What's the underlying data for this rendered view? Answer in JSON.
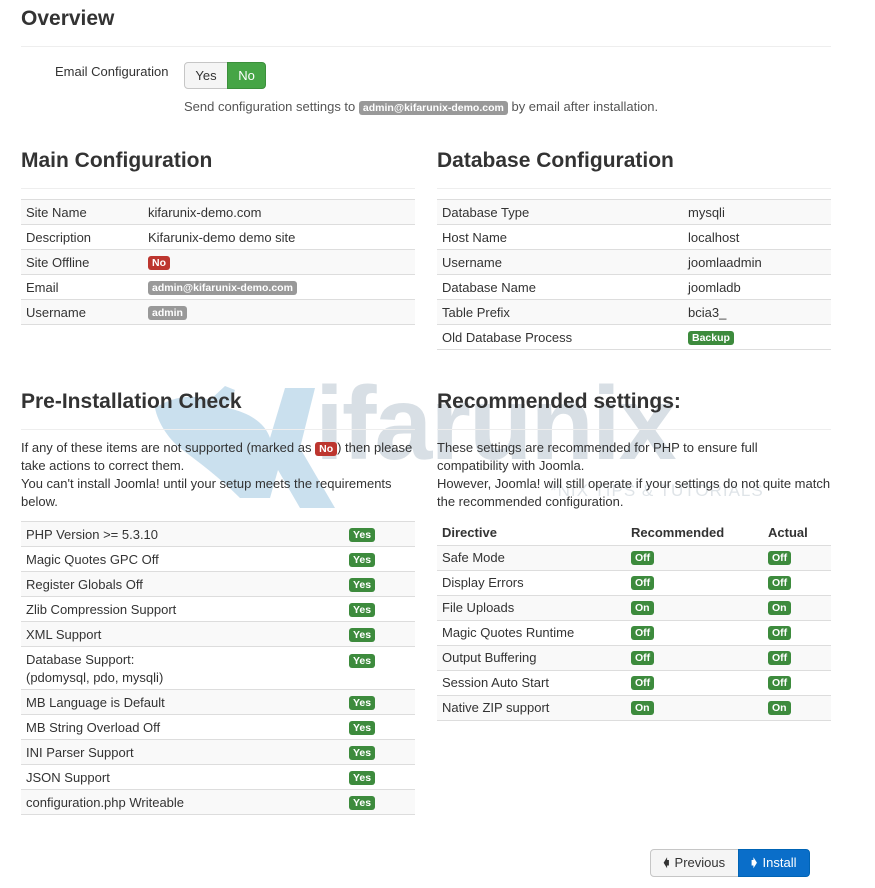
{
  "overview": {
    "title": "Overview",
    "email_config_label": "Email Configuration",
    "email_toggle": {
      "yes_label": "Yes",
      "no_label": "No",
      "selected": "No"
    },
    "email_help_prefix": "Send configuration settings to",
    "email_help_address": "admin@kifarunix-demo.com",
    "email_help_suffix": "by email after installation."
  },
  "main_config": {
    "title": "Main Configuration",
    "rows": [
      {
        "label": "Site Name",
        "value": "kifarunix-demo.com"
      },
      {
        "label": "Description",
        "value": "Kifarunix-demo demo site"
      },
      {
        "label": "Site Offline",
        "value": "No"
      },
      {
        "label": "Email",
        "value": "admin@kifarunix-demo.com"
      },
      {
        "label": "Username",
        "value": "admin"
      }
    ]
  },
  "database_config": {
    "title": "Database Configuration",
    "rows": [
      {
        "label": "Database Type",
        "value": "mysqli"
      },
      {
        "label": "Host Name",
        "value": "localhost"
      },
      {
        "label": "Username",
        "value": "joomlaadmin"
      },
      {
        "label": "Database Name",
        "value": "joomladb"
      },
      {
        "label": "Table Prefix",
        "value": "bcia3_"
      },
      {
        "label": "Old Database Process",
        "value": "Backup"
      }
    ]
  },
  "pre_install": {
    "title": "Pre-Installation Check",
    "desc_line1_prefix": "If any of these items are not supported (marked as",
    "desc_line1_badge": "No",
    "desc_line1_suffix": ") then please take actions to correct them.",
    "desc_line2": "You can't install Joomla! until your setup meets the requirements below.",
    "rows": [
      {
        "label": "PHP Version >= 5.3.10",
        "status": "Yes"
      },
      {
        "label": "Magic Quotes GPC Off",
        "status": "Yes"
      },
      {
        "label": "Register Globals Off",
        "status": "Yes"
      },
      {
        "label": "Zlib Compression Support",
        "status": "Yes"
      },
      {
        "label": "XML Support",
        "status": "Yes"
      },
      {
        "label": "Database Support:",
        "sublabel": "(pdomysql, pdo, mysqli)",
        "status": "Yes"
      },
      {
        "label": "MB Language is Default",
        "status": "Yes"
      },
      {
        "label": "MB String Overload Off",
        "status": "Yes"
      },
      {
        "label": "INI Parser Support",
        "status": "Yes"
      },
      {
        "label": "JSON Support",
        "status": "Yes"
      },
      {
        "label": "configuration.php Writeable",
        "status": "Yes"
      }
    ]
  },
  "recommended": {
    "title": "Recommended settings:",
    "desc_line1": "These settings are recommended for PHP to ensure full compatibility with Joomla.",
    "desc_line2": "However, Joomla! will still operate if your settings do not quite match the recommended configuration.",
    "headers": {
      "directive": "Directive",
      "recommended": "Recommended",
      "actual": "Actual"
    },
    "rows": [
      {
        "directive": "Safe Mode",
        "recommended": "Off",
        "actual": "Off"
      },
      {
        "directive": "Display Errors",
        "recommended": "Off",
        "actual": "Off"
      },
      {
        "directive": "File Uploads",
        "recommended": "On",
        "actual": "On"
      },
      {
        "directive": "Magic Quotes Runtime",
        "recommended": "Off",
        "actual": "Off"
      },
      {
        "directive": "Output Buffering",
        "recommended": "Off",
        "actual": "Off"
      },
      {
        "directive": "Session Auto Start",
        "recommended": "Off",
        "actual": "Off"
      },
      {
        "directive": "Native ZIP support",
        "recommended": "On",
        "actual": "On"
      }
    ]
  },
  "buttons": {
    "previous_label": "Previous",
    "previous_icon": "arrow-left-icon",
    "install_label": "Install",
    "install_icon": "arrow-right-icon"
  },
  "watermark": {
    "brand": "Kifarunix",
    "brand_rest": "ifarunix",
    "tagline": "*NIX TIPS & TUTORIALS"
  },
  "colors": {
    "success_green": "#3d8b3d",
    "toggle_green": "#46a546",
    "danger_red": "#bd362f",
    "gray_badge": "#999999",
    "primary_blue": "#0a6ec9"
  }
}
